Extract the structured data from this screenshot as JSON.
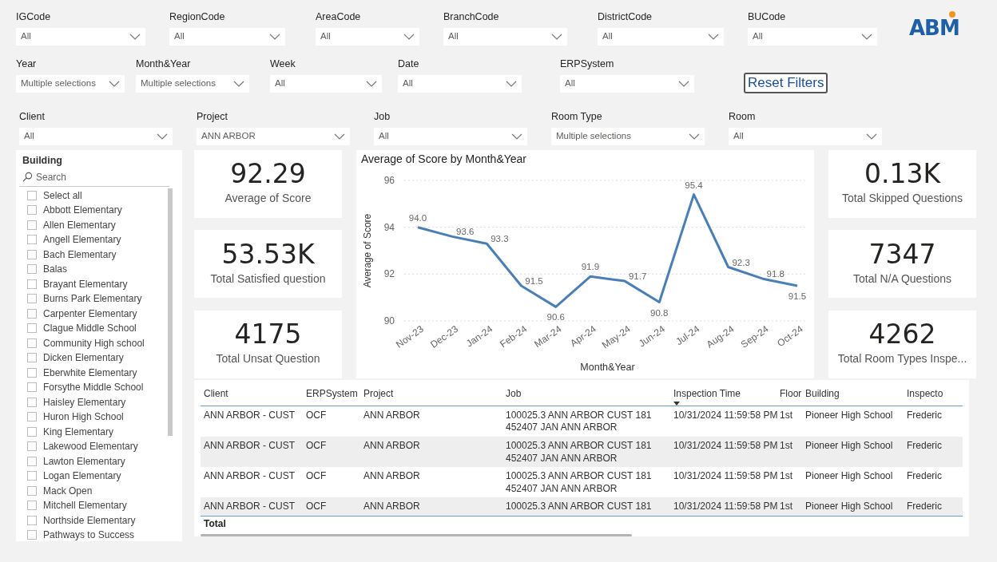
{
  "filters_row_1": [
    {
      "label": "IGCode",
      "value": "All"
    },
    {
      "label": "RegionCode",
      "value": "All"
    },
    {
      "label": "AreaCode",
      "value": "All"
    },
    {
      "label": "BranchCode",
      "value": "All"
    },
    {
      "label": "DistrictCode",
      "value": "All"
    },
    {
      "label": "BUCode",
      "value": "All"
    }
  ],
  "logo": {
    "text": "ABM"
  },
  "filters_row_2": [
    {
      "label": "Year",
      "value": "Multiple selections"
    },
    {
      "label": "Month&Year",
      "value": "Multiple selections"
    },
    {
      "label": "Week",
      "value": "All"
    },
    {
      "label": "Date",
      "value": "All"
    },
    {
      "label": "ERPSystem",
      "value": "All"
    }
  ],
  "reset_button": {
    "label": "Reset Filters"
  },
  "filters_row_3": [
    {
      "label": "Client",
      "value": "All"
    },
    {
      "label": "Project",
      "value": "ANN ARBOR"
    },
    {
      "label": "Job",
      "value": "All"
    },
    {
      "label": "Room Type",
      "value": "Multiple selections"
    },
    {
      "label": "Room",
      "value": "All"
    }
  ],
  "building_slicer": {
    "title": "Building",
    "search_placeholder": "Search",
    "items": [
      {
        "label": "Select all",
        "checked": false
      },
      {
        "label": "Abbott Elementary",
        "checked": false
      },
      {
        "label": "Allen Elementary",
        "checked": false
      },
      {
        "label": "Angell Elementary",
        "checked": false
      },
      {
        "label": "Bach Elementary",
        "checked": false
      },
      {
        "label": "Balas",
        "checked": false
      },
      {
        "label": "Brayant Elementary",
        "checked": false
      },
      {
        "label": "Burns Park Elementary",
        "checked": false
      },
      {
        "label": "Carpenter Elementary",
        "checked": false
      },
      {
        "label": "Clague Middle School",
        "checked": false
      },
      {
        "label": "Community High school",
        "checked": false
      },
      {
        "label": "Dicken Elementary",
        "checked": false
      },
      {
        "label": "Eberwhite Elementary",
        "checked": false
      },
      {
        "label": "Forsythe Middle School",
        "checked": false
      },
      {
        "label": "Haisley Elementary",
        "checked": false
      },
      {
        "label": "Huron High School",
        "checked": false
      },
      {
        "label": "King Elementary",
        "checked": false
      },
      {
        "label": "Lakewood Elementary",
        "checked": false
      },
      {
        "label": "Lawton Elementary",
        "checked": false
      },
      {
        "label": "Logan Elementary",
        "checked": false
      },
      {
        "label": "Mack Open",
        "checked": false
      },
      {
        "label": "Mitchell Elementary",
        "checked": false
      },
      {
        "label": "Northside Elementary",
        "checked": false
      },
      {
        "label": "Pathways to Success",
        "checked": false
      }
    ]
  },
  "kpis_left": [
    {
      "value": "92.29",
      "label": "Average of Score"
    },
    {
      "value": "53.53K",
      "label": "Total Satisfied question"
    },
    {
      "value": "4175",
      "label": "Total Unsat Question"
    }
  ],
  "chart": {
    "chart_data": {
      "type": "line",
      "title": "Average of Score by Month&Year",
      "xlabel": "Month&Year",
      "ylabel": "Average of Score",
      "categories": [
        "Nov-23",
        "Dec-23",
        "Jan-24",
        "Feb-24",
        "Mar-24",
        "Apr-24",
        "May-24",
        "Jun-24",
        "Jul-24",
        "Aug-24",
        "Sep-24",
        "Oct-24"
      ],
      "series": [
        {
          "color": "#4a7fb5",
          "values": [
            94.0,
            93.6,
            93.3,
            91.5,
            90.6,
            91.9,
            91.7,
            90.8,
            95.4,
            92.3,
            91.8,
            91.5
          ]
        }
      ],
      "ylim": [
        90,
        96
      ],
      "yticks": [
        90,
        92,
        94,
        96
      ],
      "value_labels": [
        "94.0",
        "93.6",
        "93.3",
        "91.5",
        "90.6",
        "91.9",
        "91.7",
        "90.8",
        "95.4",
        "92.3",
        "91.8",
        "91.5"
      ]
    }
  },
  "kpis_right": [
    {
      "value": "0.13K",
      "label": "Total Skipped Questions"
    },
    {
      "value": "7347",
      "label": "Total N/A Questions"
    },
    {
      "value": "4262",
      "label": "Total Room Types Inspe..."
    }
  ],
  "table": {
    "columns": [
      {
        "label": "Client"
      },
      {
        "label": "ERPSystem"
      },
      {
        "label": "Project"
      },
      {
        "label": "Job"
      },
      {
        "label": "Inspection Time",
        "sort_descending": true
      },
      {
        "label": "Floor"
      },
      {
        "label": "Building"
      },
      {
        "label": "Inspecto"
      }
    ],
    "rows": [
      [
        "ANN ARBOR - CUST",
        "OCF",
        "ANN ARBOR",
        "100025.3 ANN ARBOR CUST 181 452407 JAN ANN ARBOR",
        "10/31/2024 11:59:58 PM",
        "1st",
        "Pioneer High School",
        "Frederic"
      ],
      [
        "ANN ARBOR - CUST",
        "OCF",
        "ANN ARBOR",
        "100025.3 ANN ARBOR CUST 181 452407 JAN ANN ARBOR",
        "10/31/2024 11:59:58 PM",
        "1st",
        "Pioneer High School",
        "Frederic"
      ],
      [
        "ANN ARBOR - CUST",
        "OCF",
        "ANN ARBOR",
        "100025.3 ANN ARBOR CUST 181 452407 JAN ANN ARBOR",
        "10/31/2024 11:59:58 PM",
        "1st",
        "Pioneer High School",
        "Frederic"
      ],
      [
        "ANN ARBOR - CUST",
        "OCF",
        "ANN ARBOR",
        "100025.3 ANN ARBOR CUST 181",
        "10/31/2024 11:59:58 PM",
        "1st",
        "Pioneer High School",
        "Frederic"
      ]
    ],
    "total_label": "Total"
  }
}
